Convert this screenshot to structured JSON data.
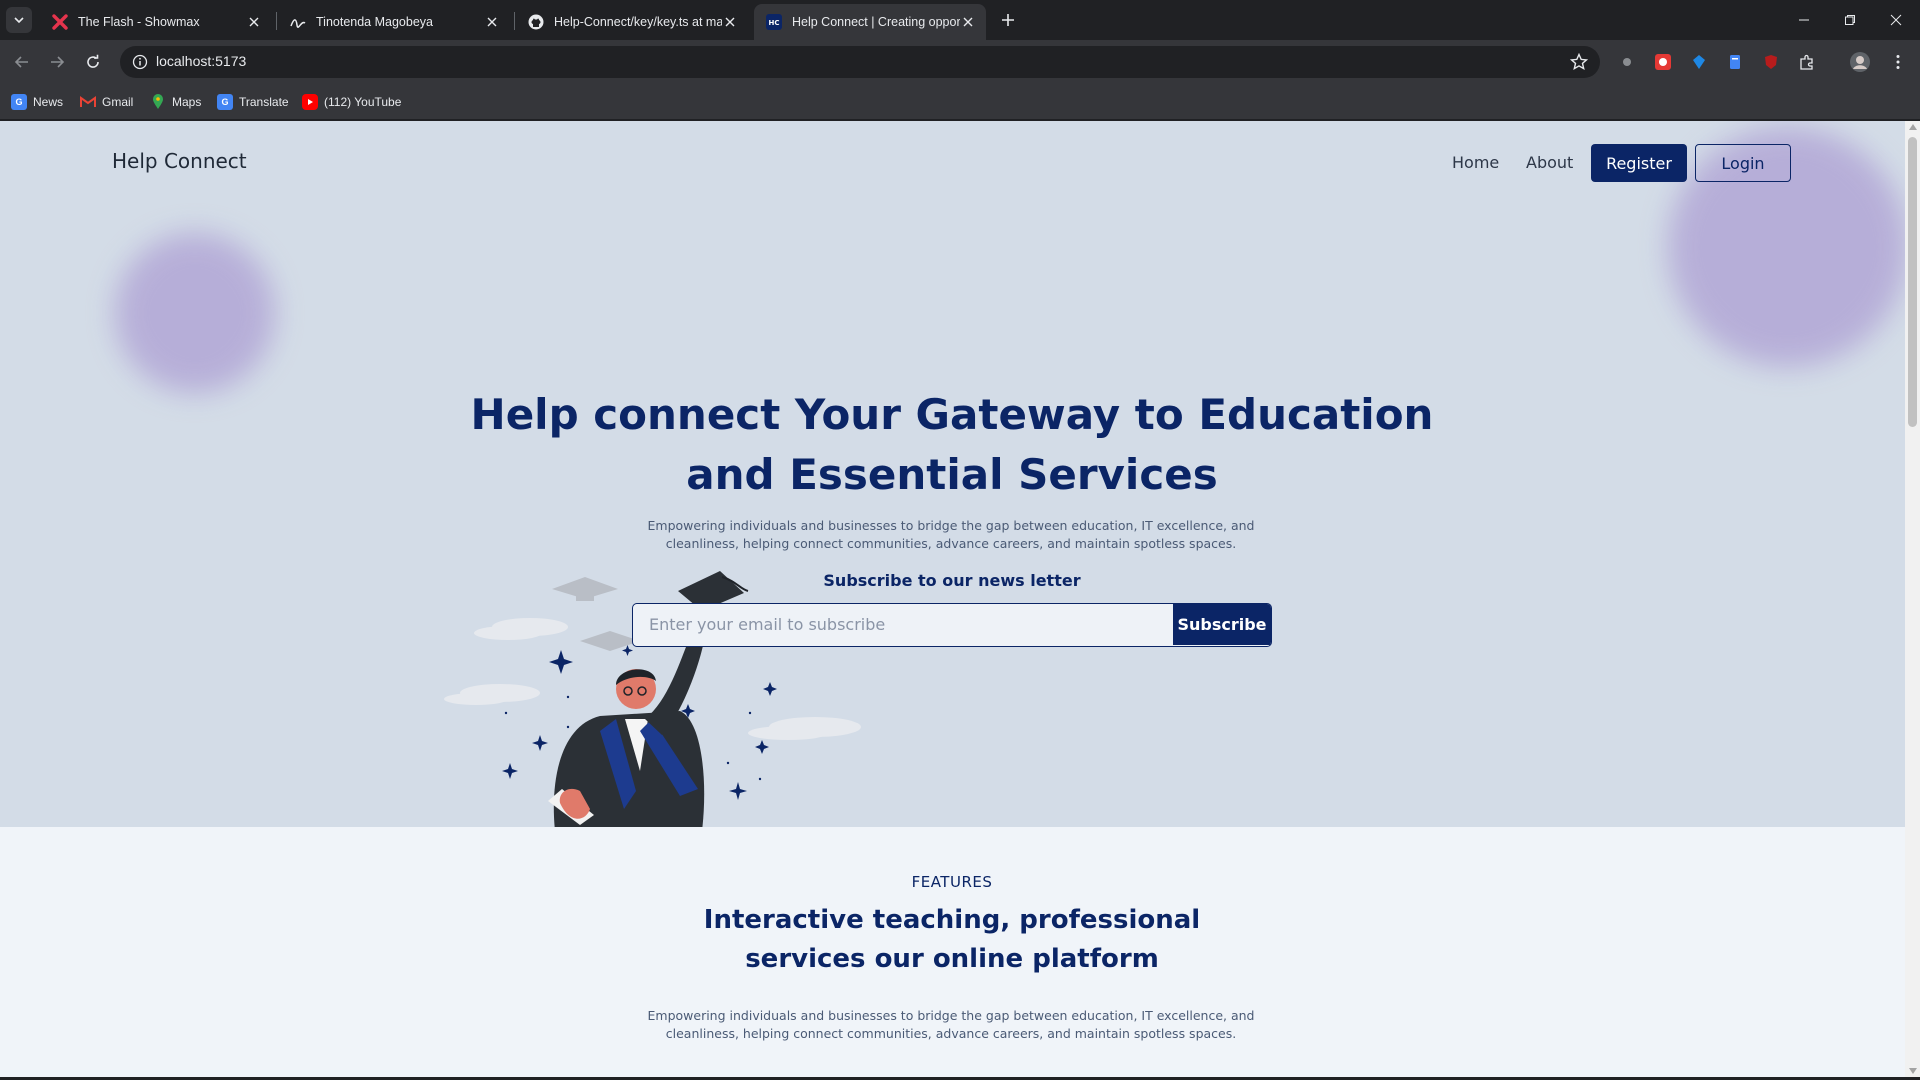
{
  "browser": {
    "tabs": [
      {
        "title": "The Flash - Showmax",
        "favicon": "showmax-x-icon"
      },
      {
        "title": "Tinotenda Magobeya",
        "favicon": "signature-icon"
      },
      {
        "title": "Help-Connect/key/key.ts at ma",
        "favicon": "github-icon"
      },
      {
        "title": "Help Connect | Creating opport",
        "favicon": "hc-icon",
        "active": true
      }
    ],
    "url": "localhost:5173",
    "bookmarks": [
      {
        "label": "News",
        "icon": "news-icon",
        "color": "#4285f4"
      },
      {
        "label": "Gmail",
        "icon": "gmail-icon",
        "color": "#ea4335"
      },
      {
        "label": "Maps",
        "icon": "maps-icon",
        "color": "#34a853"
      },
      {
        "label": "Translate",
        "icon": "translate-icon",
        "color": "#4285f4"
      },
      {
        "label": "(112) YouTube",
        "icon": "youtube-icon",
        "color": "#ff0000"
      }
    ]
  },
  "site": {
    "brand": "Help Connect",
    "nav": {
      "home": "Home",
      "about": "About",
      "register": "Register",
      "login": "Login"
    },
    "hero": {
      "title_line1": "Help connect Your Gateway to Education",
      "title_line2": "and Essential Services",
      "subtitle_line1": "Empowering individuals and businesses to bridge the gap between education, IT excellence, and",
      "subtitle_line2": "cleanliness, helping connect communities, advance careers, and maintain spotless spaces.",
      "newsletter_label": "Subscribe to our news letter",
      "email_placeholder": "Enter your email to subscribe",
      "subscribe_button": "Subscribe"
    },
    "features": {
      "eyebrow": "FEATURES",
      "title_line1": "Interactive teaching, professional",
      "title_line2": "services our online platform",
      "subtitle_line1": "Empowering individuals and businesses to bridge the gap between education, IT excellence, and",
      "subtitle_line2": "cleanliness, helping connect communities, advance careers, and maintain spotless spaces."
    }
  },
  "colors": {
    "primary": "#0b2566",
    "hero_bg": "#d3dce7",
    "page_bg": "#f0f4f9",
    "blob": "#b2a7d6"
  }
}
